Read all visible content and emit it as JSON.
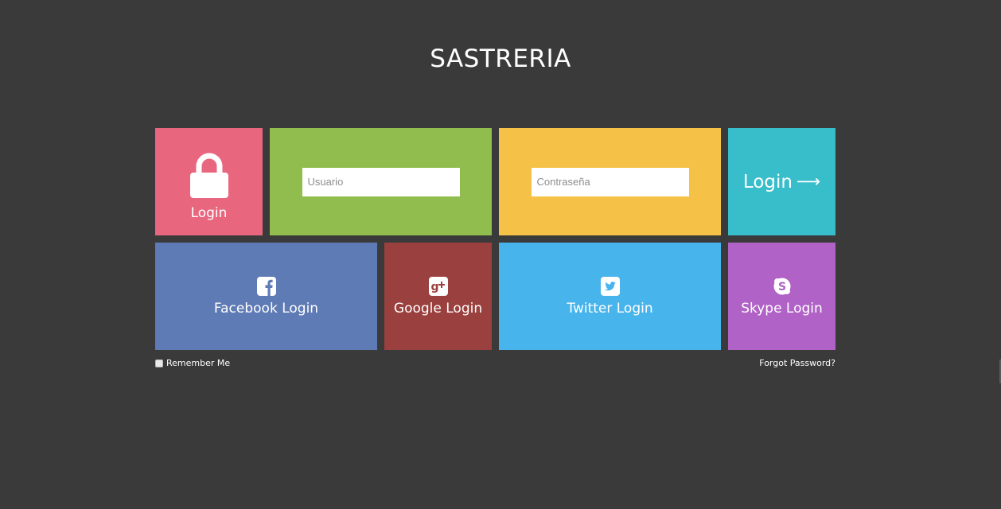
{
  "header": {
    "title": "SASTRERIA"
  },
  "lock_tile": {
    "icon": "lock-icon",
    "label": "Login",
    "color": "#e8677f"
  },
  "username": {
    "placeholder": "Usuario",
    "value": "",
    "color": "#91bd4e"
  },
  "password": {
    "placeholder": "Contraseña",
    "value": "",
    "color": "#f5c146"
  },
  "login_button": {
    "label": "Login",
    "icon": "arrow-right-icon",
    "color": "#38bdcb"
  },
  "social": {
    "facebook": {
      "label": "Facebook Login",
      "icon": "facebook-icon",
      "color": "#5f7bb5"
    },
    "google": {
      "label": "Google Login",
      "icon": "google-plus-icon",
      "color": "#9a403e"
    },
    "twitter": {
      "label": "Twitter Login",
      "icon": "twitter-icon",
      "color": "#48b4ec"
    },
    "skype": {
      "label": "Skype Login",
      "icon": "skype-icon",
      "color": "#b062c6"
    }
  },
  "footer": {
    "remember_label": "Remember Me",
    "remember_checked": false,
    "forgot_label": "Forgot Password?"
  },
  "colors": {
    "background": "#3a3a3a",
    "text": "#ffffff"
  }
}
